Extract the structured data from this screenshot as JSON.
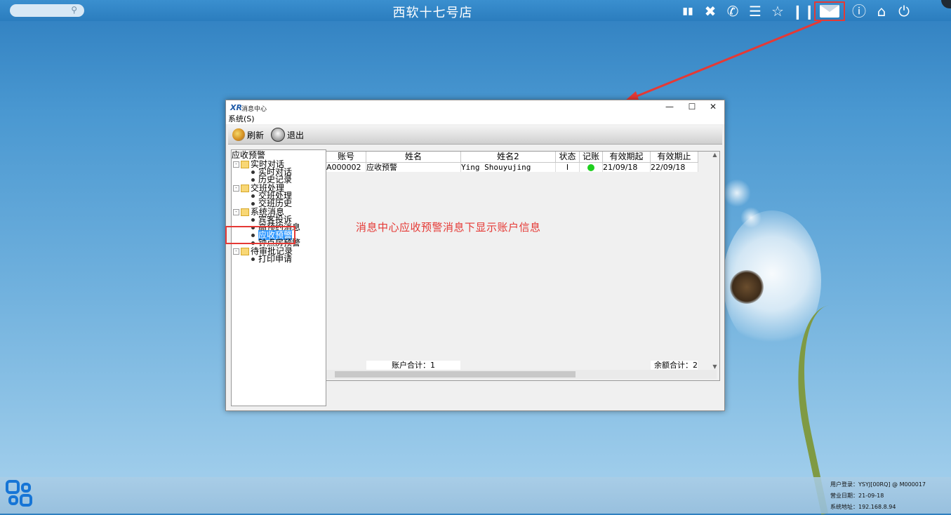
{
  "topbar": {
    "title": "西软十七号店",
    "icons": [
      "signal-icon",
      "tools-icon",
      "phone-icon",
      "menu-icon",
      "star-icon",
      "pause-icon",
      "mail-icon",
      "help-icon",
      "home-icon",
      "power-icon"
    ]
  },
  "window": {
    "title": "消息中心",
    "menu": "系统(S)",
    "toolbar": {
      "refresh": "刷新",
      "exit": "退出"
    },
    "tree": {
      "root": "应收预警",
      "groups": [
        {
          "label": "实时对话",
          "items": [
            "实时对话",
            "历史记录"
          ]
        },
        {
          "label": "交班处理",
          "items": [
            "交班处理",
            "交班历史"
          ]
        },
        {
          "label": "系统消息",
          "items": [
            "宾客投诉",
            "高预约消息",
            "应收预警",
            "钟点房预警"
          ]
        },
        {
          "label": "待审批记录",
          "items": [
            "打印申请"
          ]
        }
      ]
    },
    "table": {
      "columns": [
        "账号",
        "姓名",
        "姓名2",
        "状态",
        "记账",
        "有效期起",
        "有效期止"
      ],
      "rows": [
        {
          "account": "A000002",
          "name": "应收预警",
          "name2": "Ying Shouyujing",
          "status": "I",
          "billing": "green",
          "start": "21/09/18",
          "end": "22/09/18"
        }
      ],
      "footer": {
        "account_total": "账户合计：1",
        "balance_total": "余额合计：2"
      }
    },
    "annotation": "消息中心应收预警消息下显示账户信息"
  },
  "status": {
    "user": "用户登录：YSYJ[00RQ] @ M000017",
    "business_date": "营业日期：21-09-18",
    "address": "系统地址：192.168.8.94"
  },
  "colors": {
    "highlight_red": "#e53935",
    "accent_blue": "#1675d6",
    "status_green": "#1fcf1f"
  }
}
